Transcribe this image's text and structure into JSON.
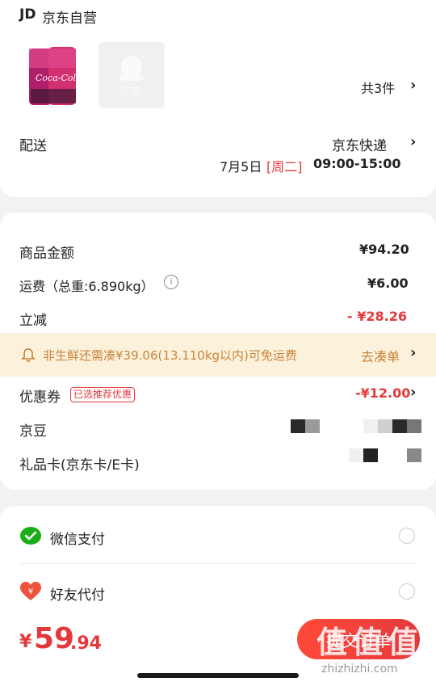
{
  "store": {
    "brand_mark": "JD",
    "name": "京东自营"
  },
  "products": {
    "count_text": "共3件",
    "placeholder_logo_text": "京东"
  },
  "delivery": {
    "label": "配送",
    "carrier": "京东快递",
    "date": "7月5日",
    "weekday": "[周二]",
    "time": "09:00-15:00"
  },
  "summary": {
    "goods_label": "商品金额",
    "goods_value": "¥94.20",
    "shipping_label": "运费（总重:6.890kg）",
    "shipping_value": "¥6.00",
    "discount_label": "立减",
    "discount_value": "- ¥28.26"
  },
  "notice": {
    "text": "非生鲜还需凑¥39.06(13.110kg以内)可免运费",
    "action": "去凑单"
  },
  "coupon": {
    "label": "优惠券",
    "tag": "已选推荐优惠",
    "value": "-¥12.00"
  },
  "jingdou": {
    "label": "京豆"
  },
  "giftcard": {
    "label": "礼品卡(京东卡/E卡)"
  },
  "payment": {
    "wechat": "微信支付",
    "friend": "好友代付"
  },
  "bottom": {
    "currency": "¥",
    "integer": "59",
    "decimal": ".94",
    "pay_button": "提交订单"
  },
  "watermark": {
    "text": "值",
    "site": "zhizhizhi.com"
  },
  "colors": {
    "accent": "#e4393c",
    "notice_bg": "#fcf2dc",
    "wechat_green": "#1aad19"
  }
}
